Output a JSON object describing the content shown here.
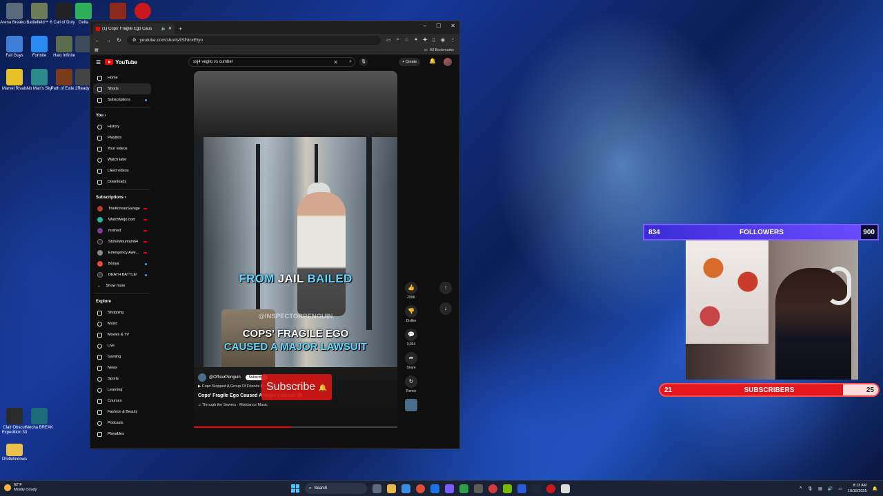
{
  "desktop": {
    "icons_top": [
      "Arena Breako...",
      "Battlefield™ 6",
      "Call of Duty",
      "Delta",
      "",
      ""
    ],
    "icons_row2": [
      "Fall Guys",
      "Fortnite",
      "Halo Infinite",
      "",
      ""
    ],
    "icons_row3": [
      "Marvel Rivals",
      "No Man's Sky",
      "Path of Exile 2",
      "Ready"
    ],
    "icons_bottom": [
      "Clair Obscur Expedition 33",
      "Mecha BREAK"
    ],
    "folder": "DS4Windows"
  },
  "browser": {
    "tab_title": "(1) Cops' Fragile Ego Caus",
    "url": "youtube.com/shorts/tSfhtcxEIyo",
    "all_bookmarks": "All Bookmarks"
  },
  "youtube": {
    "logo": "YouTube",
    "search_query": "ssj4 vegito vs cumber",
    "create_label": "Create",
    "sidebar": {
      "main": [
        {
          "label": "Home"
        },
        {
          "label": "Shorts"
        },
        {
          "label": "Subscriptions"
        }
      ],
      "you_heading": "You",
      "you": [
        {
          "label": "History"
        },
        {
          "label": "Playlists"
        },
        {
          "label": "Your videos"
        },
        {
          "label": "Watch later"
        },
        {
          "label": "Liked videos"
        },
        {
          "label": "Downloads"
        }
      ],
      "subs_heading": "Subscriptions",
      "subs": [
        {
          "label": "TheKoreanSavage",
          "color": "#c0392b"
        },
        {
          "label": "WatchMojo.com",
          "color": "#1abc9c"
        },
        {
          "label": "mrshed",
          "color": "#7d3c98"
        },
        {
          "label": "StoneMountain64",
          "color": "#222222"
        },
        {
          "label": "Emergency Awe...",
          "color": "#888888"
        },
        {
          "label": "Booya",
          "color": "#e74c3c"
        },
        {
          "label": "DEATH BATTLE!",
          "color": "#333333"
        }
      ],
      "show_more": "Show more",
      "explore_heading": "Explore",
      "explore": [
        {
          "label": "Shopping"
        },
        {
          "label": "Music"
        },
        {
          "label": "Movies & TV"
        },
        {
          "label": "Live"
        },
        {
          "label": "Gaming"
        },
        {
          "label": "News"
        },
        {
          "label": "Sports"
        },
        {
          "label": "Learning"
        },
        {
          "label": "Courses"
        },
        {
          "label": "Fashion & Beauty"
        },
        {
          "label": "Podcasts"
        },
        {
          "label": "Playables"
        }
      ]
    },
    "short": {
      "caption_from": "FROM",
      "caption_jail": "JAIL",
      "caption_bailed": "BAILED",
      "watermark": "@INSPECTORPENGUIN",
      "caption_line1": "COPS' FRAGILE EGO",
      "caption_line2": "CAUSED A MAJOR LAWSUIT",
      "channel": "@OfficerPenguin",
      "subscribe": "Subscribe",
      "subscribe_overlay": "Subscribe",
      "description": "Cops Stopped A Group Of Friends Driving Around And Then th...",
      "title": "Cops' Fragile Ego Caused A Major Lawsuit 😳",
      "music": "Through the Sewers · Mistdance Music",
      "progress": 0.48
    },
    "actions": {
      "likes": "299K",
      "dislike": "Dislike",
      "comments": "9,934",
      "share": "Share",
      "remix": "Remix"
    }
  },
  "overlays": {
    "followers": {
      "label": "FOLLOWERS",
      "current": "834",
      "goal": "900",
      "progress": 0.93
    },
    "subscribers": {
      "label": "SUBSCRIBERS",
      "current": "21",
      "goal": "25",
      "progress": 0.84
    }
  },
  "taskbar": {
    "temp": "62°F",
    "weather": "Mostly cloudy",
    "search": "Search",
    "time": "8:13 AM",
    "date": "10/15/2025"
  }
}
